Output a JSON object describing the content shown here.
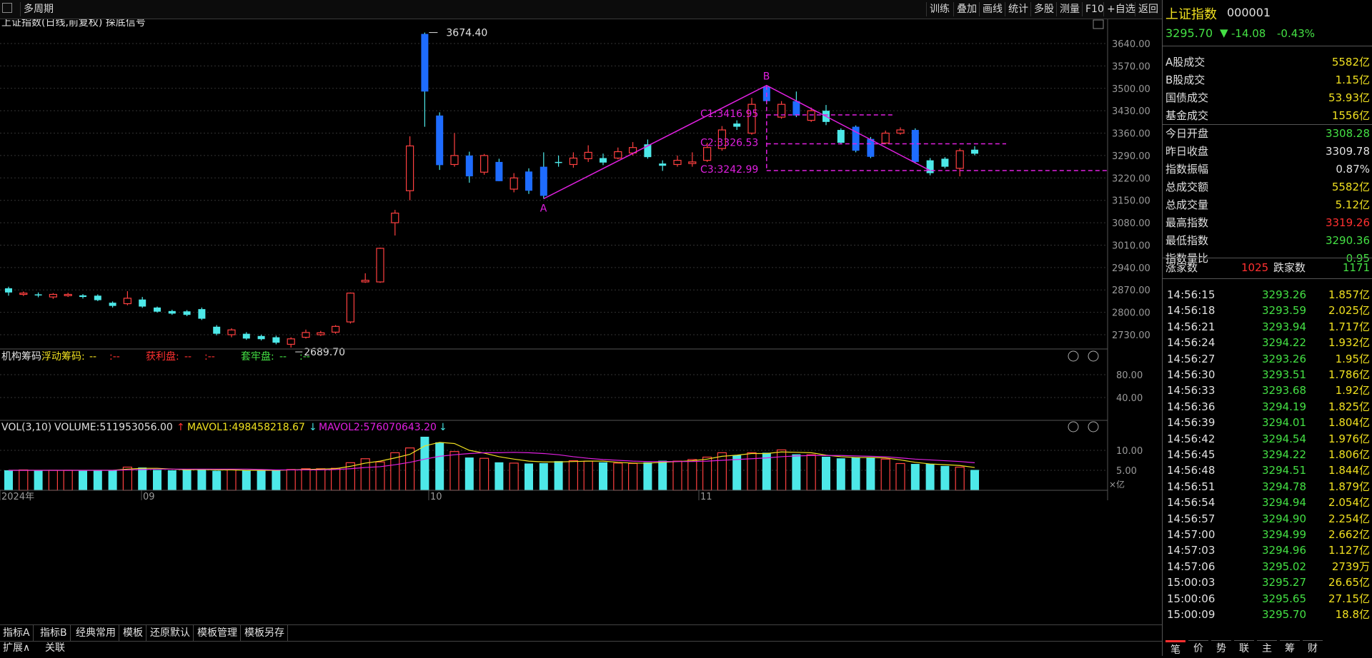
{
  "toolbar": {
    "left_icon": "grid-icon",
    "period_label": "多周期",
    "buttons": [
      "训练",
      "叠加",
      "画线",
      "统计",
      "多股",
      "测量",
      "F10",
      "+自选",
      "返回"
    ]
  },
  "chart_header": {
    "title": "上证指数(日线,前复权) 探底信号"
  },
  "price_axis": [
    "3640.00",
    "3570.00",
    "3500.00",
    "3430.00",
    "3360.00",
    "3290.00",
    "3220.00",
    "3150.00",
    "3080.00",
    "3010.00",
    "2940.00",
    "2870.00",
    "2800.00",
    "2730.00"
  ],
  "annotations": {
    "high_label": "3674.40",
    "low_label": "2689.70",
    "point_a": "A",
    "point_b": "B",
    "c1": "C1:3416.95",
    "c2": "C2:3326.53",
    "c3": "C3:3242.99"
  },
  "indicator_panel": {
    "name": "机构筹码",
    "float_label": "浮动筹码:",
    "float_val": "--",
    "sep1": ":--",
    "profit_label": "获利盘:",
    "profit_val": "--",
    "sep2": ":--",
    "locked_label": "套牢盘:",
    "locked_val": "--",
    "sep3": ":--",
    "axis": [
      "80.00",
      "40.00"
    ]
  },
  "volume_panel": {
    "vol_label": "VOL(3,10)",
    "volume": "VOLUME:511953056.00",
    "up_arrow": "↑",
    "mavol1": "MAVOL1:498458218.67",
    "down_arrow1": "↓",
    "mavol2": "MAVOL2:576070643.20",
    "down_arrow2": "↓",
    "axis": [
      "10.00",
      "5.00"
    ],
    "unit": "×亿"
  },
  "date_axis": [
    "2024年",
    "09",
    "10",
    "11"
  ],
  "bottom_tabs": [
    "指标A",
    "指标B",
    "经典常用",
    "模板",
    "还原默认",
    "模板管理",
    "模板另存"
  ],
  "bottom_tabs2": [
    "扩展∧",
    "关联"
  ],
  "quote": {
    "name": "上证指数",
    "code": "000001",
    "price": "3295.70",
    "change_arrow": "▼",
    "change": "-14.08",
    "pct": "-0.43%",
    "rows": [
      {
        "label": "A股成交",
        "value": "5582亿",
        "color": "#f0e020"
      },
      {
        "label": "B股成交",
        "value": "1.15亿",
        "color": "#f0e020"
      },
      {
        "label": "国债成交",
        "value": "53.93亿",
        "color": "#f0e020"
      },
      {
        "label": "基金成交",
        "value": "1556亿",
        "color": "#f0e020"
      },
      {
        "label": "今日开盘",
        "value": "3308.28",
        "color": "#44e044"
      },
      {
        "label": "昨日收盘",
        "value": "3309.78",
        "color": "#e0e0e0"
      },
      {
        "label": "指数振幅",
        "value": "0.87%",
        "color": "#e0e0e0"
      },
      {
        "label": "总成交额",
        "value": "5582亿",
        "color": "#f0e020"
      },
      {
        "label": "总成交量",
        "value": "5.12亿",
        "color": "#f0e020"
      },
      {
        "label": "最高指数",
        "value": "3319.26",
        "color": "#ff3030"
      },
      {
        "label": "最低指数",
        "value": "3290.36",
        "color": "#44e044"
      },
      {
        "label": "指数量比",
        "value": "0.95",
        "color": "#44e044"
      }
    ],
    "up_label": "涨家数",
    "up_count": "1025",
    "down_label": "跌家数",
    "down_count": "1171"
  },
  "ticks": [
    {
      "time": "14:56:15",
      "price": "3293.26",
      "vol": "1.857亿"
    },
    {
      "time": "14:56:18",
      "price": "3293.59",
      "vol": "2.025亿"
    },
    {
      "time": "14:56:21",
      "price": "3293.94",
      "vol": "1.717亿"
    },
    {
      "time": "14:56:24",
      "price": "3294.22",
      "vol": "1.932亿"
    },
    {
      "time": "14:56:27",
      "price": "3293.26",
      "vol": "1.95亿"
    },
    {
      "time": "14:56:30",
      "price": "3293.51",
      "vol": "1.786亿"
    },
    {
      "time": "14:56:33",
      "price": "3293.68",
      "vol": "1.92亿"
    },
    {
      "time": "14:56:36",
      "price": "3294.19",
      "vol": "1.825亿"
    },
    {
      "time": "14:56:39",
      "price": "3294.01",
      "vol": "1.804亿"
    },
    {
      "time": "14:56:42",
      "price": "3294.54",
      "vol": "1.976亿"
    },
    {
      "time": "14:56:45",
      "price": "3294.22",
      "vol": "1.806亿"
    },
    {
      "time": "14:56:48",
      "price": "3294.51",
      "vol": "1.844亿"
    },
    {
      "time": "14:56:51",
      "price": "3294.78",
      "vol": "1.879亿"
    },
    {
      "time": "14:56:54",
      "price": "3294.94",
      "vol": "2.054亿"
    },
    {
      "time": "14:56:57",
      "price": "3294.90",
      "vol": "2.254亿"
    },
    {
      "time": "14:57:00",
      "price": "3294.99",
      "vol": "2.662亿"
    },
    {
      "time": "14:57:03",
      "price": "3294.96",
      "vol": "1.127亿"
    },
    {
      "time": "14:57:06",
      "price": "3295.02",
      "vol": "2739万"
    },
    {
      "time": "15:00:03",
      "price": "3295.27",
      "vol": "26.65亿"
    },
    {
      "time": "15:00:06",
      "price": "3295.65",
      "vol": "27.15亿"
    },
    {
      "time": "15:00:09",
      "price": "3295.70",
      "vol": "18.8亿"
    }
  ],
  "right_tabs": [
    "笔",
    "价",
    "势",
    "联",
    "主",
    "筹",
    "财"
  ],
  "chart_data": {
    "type": "candlestick",
    "title": "上证指数(日线,前复权) 探底信号",
    "ylim": [
      2680,
      3680
    ],
    "candles": [
      {
        "o": 2875,
        "c": 2862,
        "h": 2880,
        "l": 2852,
        "dir": "down"
      },
      {
        "o": 2856,
        "c": 2860,
        "h": 2865,
        "l": 2851,
        "dir": "up"
      },
      {
        "o": 2856,
        "c": 2853,
        "h": 2862,
        "l": 2847,
        "dir": "down"
      },
      {
        "o": 2848,
        "c": 2856,
        "h": 2860,
        "l": 2842,
        "dir": "up"
      },
      {
        "o": 2852,
        "c": 2856,
        "h": 2861,
        "l": 2848,
        "dir": "up"
      },
      {
        "o": 2853,
        "c": 2848,
        "h": 2857,
        "l": 2843,
        "dir": "down"
      },
      {
        "o": 2852,
        "c": 2838,
        "h": 2856,
        "l": 2835,
        "dir": "down"
      },
      {
        "o": 2830,
        "c": 2820,
        "h": 2834,
        "l": 2815,
        "dir": "down"
      },
      {
        "o": 2827,
        "c": 2844,
        "h": 2866,
        "l": 2822,
        "dir": "up"
      },
      {
        "o": 2840,
        "c": 2818,
        "h": 2848,
        "l": 2814,
        "dir": "down"
      },
      {
        "o": 2815,
        "c": 2802,
        "h": 2818,
        "l": 2799,
        "dir": "down"
      },
      {
        "o": 2804,
        "c": 2796,
        "h": 2808,
        "l": 2792,
        "dir": "down"
      },
      {
        "o": 2803,
        "c": 2792,
        "h": 2807,
        "l": 2788,
        "dir": "down"
      },
      {
        "o": 2810,
        "c": 2780,
        "h": 2815,
        "l": 2776,
        "dir": "down"
      },
      {
        "o": 2755,
        "c": 2733,
        "h": 2760,
        "l": 2728,
        "dir": "down"
      },
      {
        "o": 2730,
        "c": 2745,
        "h": 2750,
        "l": 2722,
        "dir": "up"
      },
      {
        "o": 2733,
        "c": 2718,
        "h": 2738,
        "l": 2714,
        "dir": "down"
      },
      {
        "o": 2726,
        "c": 2716,
        "h": 2730,
        "l": 2712,
        "dir": "down"
      },
      {
        "o": 2722,
        "c": 2705,
        "h": 2727,
        "l": 2700,
        "dir": "down"
      },
      {
        "o": 2700,
        "c": 2717,
        "h": 2722,
        "l": 2689.7,
        "dir": "up"
      },
      {
        "o": 2722,
        "c": 2737,
        "h": 2746,
        "l": 2718,
        "dir": "up"
      },
      {
        "o": 2730,
        "c": 2736,
        "h": 2742,
        "l": 2726,
        "dir": "up"
      },
      {
        "o": 2738,
        "c": 2756,
        "h": 2760,
        "l": 2733,
        "dir": "up"
      },
      {
        "o": 2770,
        "c": 2860,
        "h": 2862,
        "l": 2765,
        "dir": "up"
      },
      {
        "o": 2895,
        "c": 2900,
        "h": 2922,
        "l": 2892,
        "dir": "up"
      },
      {
        "o": 2895,
        "c": 3000,
        "h": 3002,
        "l": 2892,
        "dir": "up"
      },
      {
        "o": 3080,
        "c": 3110,
        "h": 3120,
        "l": 3040,
        "dir": "up"
      },
      {
        "o": 3180,
        "c": 3320,
        "h": 3350,
        "l": 3150,
        "dir": "up"
      },
      {
        "o": 3670,
        "c": 3490,
        "h": 3674.4,
        "l": 3380,
        "dir": "down"
      },
      {
        "o": 3415,
        "c": 3260,
        "h": 3425,
        "l": 3245,
        "dir": "down"
      },
      {
        "o": 3262,
        "c": 3290,
        "h": 3360,
        "l": 3255,
        "dir": "up"
      },
      {
        "o": 3290,
        "c": 3225,
        "h": 3302,
        "l": 3205,
        "dir": "down"
      },
      {
        "o": 3238,
        "c": 3290,
        "h": 3295,
        "l": 3230,
        "dir": "up"
      },
      {
        "o": 3270,
        "c": 3210,
        "h": 3280,
        "l": 3210,
        "dir": "down"
      },
      {
        "o": 3185,
        "c": 3220,
        "h": 3235,
        "l": 3175,
        "dir": "up"
      },
      {
        "o": 3240,
        "c": 3180,
        "h": 3250,
        "l": 3170,
        "dir": "down"
      },
      {
        "o": 3255,
        "c": 3164,
        "h": 3300,
        "l": 3155,
        "dir": "down"
      },
      {
        "o": 3270,
        "c": 3270,
        "h": 3290,
        "l": 3255,
        "dir": "down"
      },
      {
        "o": 3262,
        "c": 3282,
        "h": 3300,
        "l": 3252,
        "dir": "up"
      },
      {
        "o": 3280,
        "c": 3300,
        "h": 3322,
        "l": 3270,
        "dir": "up"
      },
      {
        "o": 3268,
        "c": 3282,
        "h": 3296,
        "l": 3260,
        "dir": "down"
      },
      {
        "o": 3282,
        "c": 3302,
        "h": 3315,
        "l": 3278,
        "dir": "up"
      },
      {
        "o": 3298,
        "c": 3315,
        "h": 3332,
        "l": 3290,
        "dir": "up"
      },
      {
        "o": 3325,
        "c": 3285,
        "h": 3340,
        "l": 3280,
        "dir": "down"
      },
      {
        "o": 3265,
        "c": 3258,
        "h": 3275,
        "l": 3242,
        "dir": "down"
      },
      {
        "o": 3262,
        "c": 3275,
        "h": 3290,
        "l": 3255,
        "dir": "up"
      },
      {
        "o": 3265,
        "c": 3270,
        "h": 3300,
        "l": 3255,
        "dir": "up"
      },
      {
        "o": 3275,
        "c": 3315,
        "h": 3330,
        "l": 3270,
        "dir": "up"
      },
      {
        "o": 3312,
        "c": 3370,
        "h": 3382,
        "l": 3305,
        "dir": "up"
      },
      {
        "o": 3390,
        "c": 3380,
        "h": 3400,
        "l": 3370,
        "dir": "down"
      },
      {
        "o": 3360,
        "c": 3450,
        "h": 3470,
        "l": 3355,
        "dir": "up"
      },
      {
        "o": 3505,
        "c": 3460,
        "h": 3510,
        "l": 3450,
        "dir": "down"
      },
      {
        "o": 3410,
        "c": 3450,
        "h": 3460,
        "l": 3405,
        "dir": "up"
      },
      {
        "o": 3460,
        "c": 3415,
        "h": 3490,
        "l": 3410,
        "dir": "down"
      },
      {
        "o": 3400,
        "c": 3430,
        "h": 3440,
        "l": 3395,
        "dir": "up"
      },
      {
        "o": 3430,
        "c": 3395,
        "h": 3448,
        "l": 3385,
        "dir": "down"
      },
      {
        "o": 3370,
        "c": 3330,
        "h": 3375,
        "l": 3325,
        "dir": "down"
      },
      {
        "o": 3380,
        "c": 3305,
        "h": 3384,
        "l": 3300,
        "dir": "down"
      },
      {
        "o": 3342,
        "c": 3286,
        "h": 3348,
        "l": 3282,
        "dir": "down"
      },
      {
        "o": 3329,
        "c": 3360,
        "h": 3368,
        "l": 3325,
        "dir": "up"
      },
      {
        "o": 3360,
        "c": 3370,
        "h": 3378,
        "l": 3355,
        "dir": "up"
      },
      {
        "o": 3370,
        "c": 3270,
        "h": 3375,
        "l": 3265,
        "dir": "down"
      },
      {
        "o": 3275,
        "c": 3235,
        "h": 3282,
        "l": 3228,
        "dir": "down"
      },
      {
        "o": 3280,
        "c": 3255,
        "h": 3285,
        "l": 3250,
        "dir": "down"
      },
      {
        "o": 3250,
        "c": 3305,
        "h": 3312,
        "l": 3225,
        "dir": "up"
      },
      {
        "o": 3308.28,
        "c": 3295.7,
        "h": 3319.26,
        "l": 3290.36,
        "dir": "down"
      }
    ],
    "volume": [
      5.0,
      5.1,
      5.0,
      5.0,
      5.0,
      4.9,
      5.1,
      5.0,
      5.8,
      5.7,
      5.1,
      5.0,
      5.2,
      5.3,
      4.9,
      5.1,
      5.0,
      5.0,
      5.0,
      5.2,
      5.4,
      5.4,
      5.5,
      6.9,
      7.9,
      7.1,
      9.4,
      10.6,
      13.4,
      12.0,
      9.7,
      8.2,
      8.0,
      7.0,
      6.8,
      6.7,
      6.8,
      7.3,
      7.4,
      7.3,
      7.0,
      6.8,
      6.7,
      7.0,
      7.4,
      7.3,
      7.7,
      8.3,
      9.4,
      8.8,
      9.4,
      9.4,
      10.1,
      9.0,
      8.9,
      8.4,
      8.0,
      8.3,
      8.2,
      7.8,
      6.7,
      6.6,
      6.6,
      6.1,
      5.8,
      5.1
    ],
    "mavol1": [
      5.0,
      5.0,
      5.0,
      5.0,
      5.0,
      5.0,
      5.0,
      5.0,
      5.3,
      5.5,
      5.5,
      5.3,
      5.1,
      5.2,
      5.1,
      5.1,
      5.0,
      5.0,
      5.0,
      5.1,
      5.2,
      5.3,
      5.4,
      6.0,
      6.8,
      7.3,
      8.1,
      9.0,
      11.1,
      12.0,
      11.7,
      10.0,
      9.3,
      8.4,
      7.8,
      7.3,
      7.1,
      7.1,
      7.2,
      7.3,
      7.3,
      7.0,
      6.8,
      6.8,
      7.0,
      7.2,
      7.4,
      7.8,
      8.5,
      8.8,
      9.2,
      9.2,
      9.6,
      9.5,
      9.4,
      8.8,
      8.4,
      8.2,
      8.2,
      8.1,
      7.6,
      7.0,
      6.6,
      6.4,
      6.2,
      5.7
    ],
    "mavol2": [
      5.0,
      5.0,
      5.0,
      5.0,
      5.0,
      5.0,
      5.0,
      5.0,
      5.1,
      5.2,
      5.3,
      5.3,
      5.3,
      5.3,
      5.3,
      5.3,
      5.3,
      5.2,
      5.1,
      5.1,
      5.1,
      5.1,
      5.2,
      5.4,
      5.7,
      5.9,
      6.4,
      7.0,
      7.8,
      8.5,
      8.9,
      9.2,
      9.4,
      9.4,
      9.5,
      9.4,
      9.2,
      8.9,
      8.4,
      8.0,
      7.7,
      7.5,
      7.3,
      7.2,
      7.2,
      7.2,
      7.2,
      7.3,
      7.5,
      7.7,
      7.9,
      8.1,
      8.4,
      8.6,
      8.7,
      8.7,
      8.7,
      8.6,
      8.5,
      8.4,
      8.1,
      7.8,
      7.6,
      7.4,
      7.2,
      6.9
    ]
  }
}
